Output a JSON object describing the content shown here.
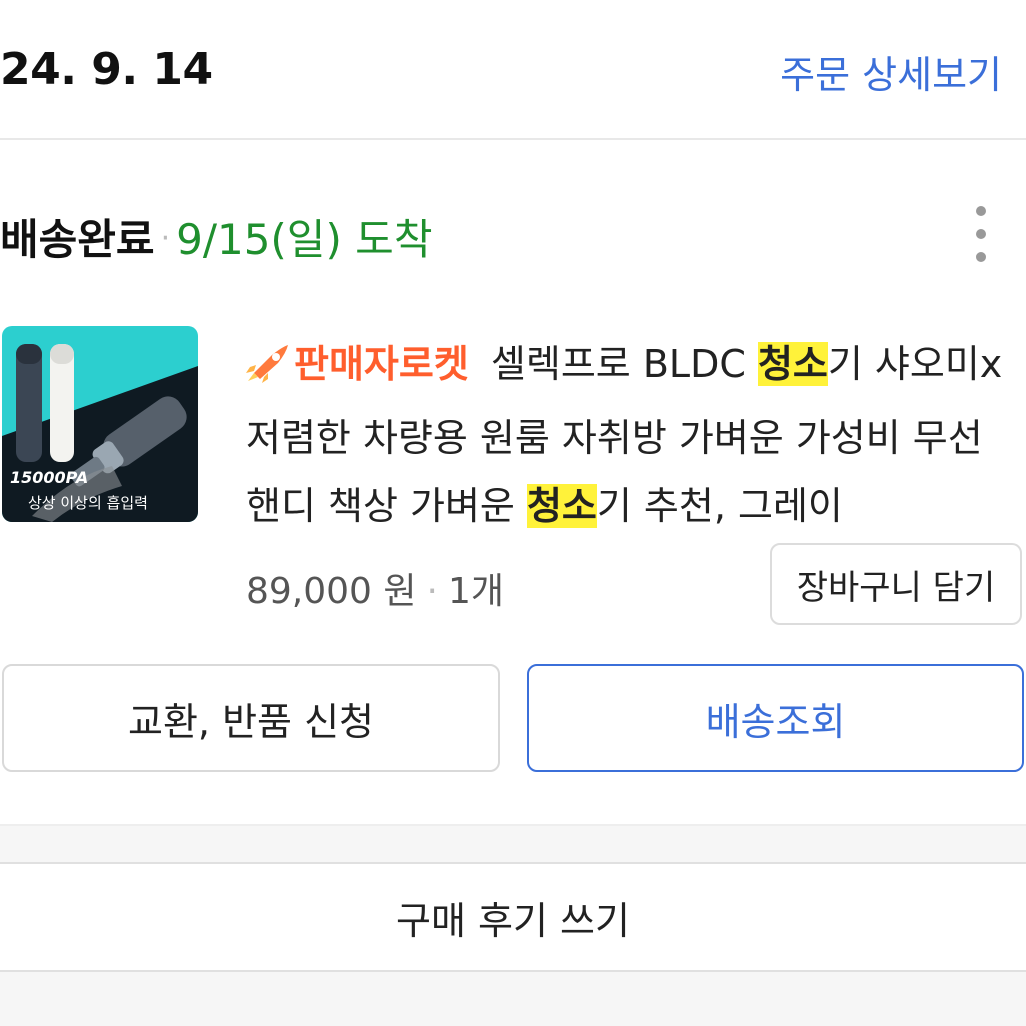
{
  "order": {
    "date": "24. 9. 14",
    "detail_link": "주문 상세보기"
  },
  "delivery": {
    "status": "배송완료",
    "separator": "·",
    "arrival": "9/15(일) 도착"
  },
  "product": {
    "image_text": {
      "suction": "15000PA",
      "tagline": "상상 이상의 흡입력"
    },
    "badge": "판매자로켓",
    "title_parts": [
      "셀렉프로 BLDC ",
      "청소",
      "기 샤오미x 저렴한 차량용 원룸 자취방 가벼운 가성비 무선 핸디 책상 가벼운 ",
      "청소",
      "기 추천, 그레이"
    ],
    "price": "89,000 원",
    "price_separator": "·",
    "quantity": "1개",
    "cart_button": "장바구니 담기"
  },
  "actions": {
    "exchange_button": "교환, 반품 신청",
    "track_button": "배송조회",
    "review_button": "구매 후기 쓰기"
  },
  "colors": {
    "link_blue": "#3b6fd9",
    "arrival_green": "#1f8f2e",
    "badge_orange": "#ff5e2d",
    "highlight_yellow": "#fff23a",
    "thumbnail_teal": "#2ccfcf"
  },
  "icons": {
    "more": "more-vertical-icon",
    "rocket": "rocket-icon"
  }
}
